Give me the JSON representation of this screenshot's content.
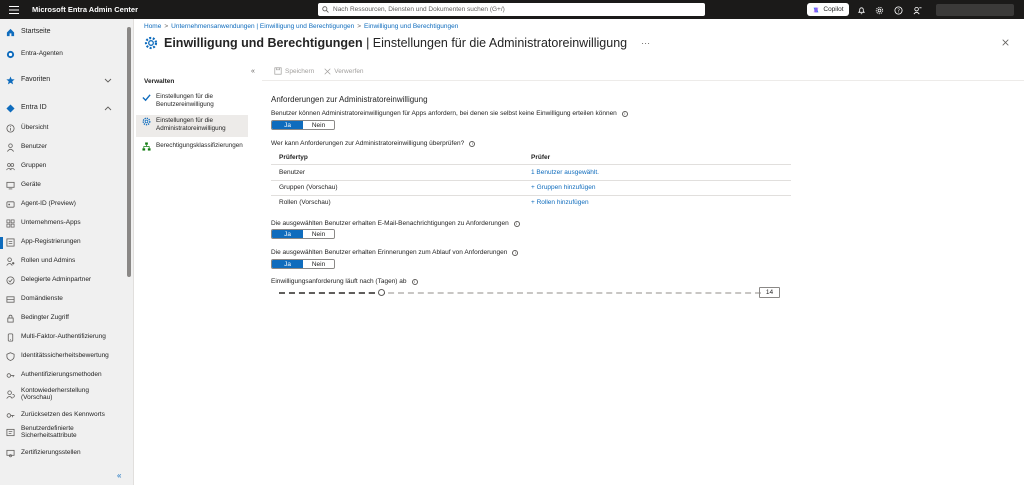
{
  "app": {
    "title": "Microsoft Entra Admin Center",
    "search_placeholder": "Nach Ressourcen, Diensten und Dokumenten suchen (G+/)",
    "copilot_label": "Copilot"
  },
  "nav": {
    "items": [
      {
        "label": "Startseite",
        "icon": "home-icon",
        "section": true
      },
      {
        "label": "Entra-Agenten",
        "icon": "agent-icon"
      },
      {
        "label": "Favoriten",
        "icon": "star-icon",
        "section": true
      },
      {
        "label": "Entra ID",
        "icon": "diamond-icon",
        "section": true
      },
      {
        "label": "Übersicht",
        "icon": "info-icon"
      },
      {
        "label": "Benutzer",
        "icon": "user-icon"
      },
      {
        "label": "Gruppen",
        "icon": "group-icon"
      },
      {
        "label": "Geräte",
        "icon": "device-icon"
      },
      {
        "label": "Agent-ID (Preview)",
        "icon": "agent-id-icon"
      },
      {
        "label": "Unternehmens-Apps",
        "icon": "apps-icon"
      },
      {
        "label": "App-Registrierungen",
        "icon": "app-registration-icon"
      },
      {
        "label": "Rollen und Admins",
        "icon": "roles-icon"
      },
      {
        "label": "Delegierte Adminpartner",
        "icon": "partner-icon"
      },
      {
        "label": "Domändienste",
        "icon": "domain-icon"
      },
      {
        "label": "Bedingter Zugriff",
        "icon": "conditional-access-icon"
      },
      {
        "label": "Multi-Faktor-Authentifizierung",
        "icon": "mfa-icon"
      },
      {
        "label": "Identitätssicherheitsbewertung",
        "icon": "score-icon"
      },
      {
        "label": "Authentifizierungsmethoden",
        "icon": "key-icon"
      },
      {
        "label": "Kontowiederherstellung (Vorschau)",
        "icon": "recovery-icon"
      },
      {
        "label": "Zurücksetzen des Kennworts",
        "icon": "password-reset-icon"
      },
      {
        "label": "Benutzerdefinierte Sicherheitsattribute",
        "icon": "attribute-icon"
      },
      {
        "label": "Zertifizierungsstellen",
        "icon": "certificate-icon"
      }
    ],
    "collapse_glyph": "«"
  },
  "breadcrumb": [
    "Home",
    "Unternehmensanwendungen | Einwilligung und Berechtigungen",
    "Einwilligung und Berechtigungen"
  ],
  "page": {
    "title_bold": "Einwilligung und Berechtigungen",
    "title_rest": " | Einstellungen für die Administratoreinwilligung",
    "more": "···"
  },
  "submenu": {
    "header": "Verwalten",
    "items": [
      {
        "label": "Einstellungen für die Benutzereinwilligung"
      },
      {
        "label": "Einstellungen für die Administratoreinwilligung",
        "selected": true
      },
      {
        "label": "Berechtigungsklassifizierungen"
      }
    ]
  },
  "toolbar": {
    "save_label": "Speichern",
    "discard_label": "Verwerfen"
  },
  "content": {
    "section_title": "Anforderungen zur Administratoreinwilligung",
    "q1": "Benutzer können Administratoreinwilligungen für Apps anfordern, bei denen sie selbst keine Einwilligung erteilen können",
    "toggle_yes": "Ja",
    "toggle_no": "Nein",
    "toggle1_value": "Ja",
    "q2": "Wer kann Anforderungen zur Administratoreinwilligung überprüfen?",
    "table": {
      "col1": "Prüfertyp",
      "col2": "Prüfer",
      "rows": [
        {
          "type": "Benutzer",
          "reviewer": "1 Benutzer ausgewählt."
        },
        {
          "type": "Gruppen (Vorschau)",
          "reviewer": "+ Gruppen hinzufügen"
        },
        {
          "type": "Rollen (Vorschau)",
          "reviewer": "+ Rollen hinzufügen"
        }
      ]
    },
    "q3": "Die ausgewählten Benutzer erhalten E-Mail-Benachrichtigungen zu Anforderungen",
    "toggle3_value": "Ja",
    "q4": "Die ausgewählten Benutzer erhalten Erinnerungen zum Ablauf von Anforderungen",
    "toggle4_value": "Ja",
    "q5": "Einwilligungsanforderung läuft nach (Tagen) ab",
    "slider": {
      "value": "14",
      "min": 1,
      "max": 30,
      "current": 14
    }
  },
  "colors": {
    "accent": "#0f6cbd",
    "topbar": "#1b1a19",
    "nav_bg": "#f0f0f0"
  }
}
